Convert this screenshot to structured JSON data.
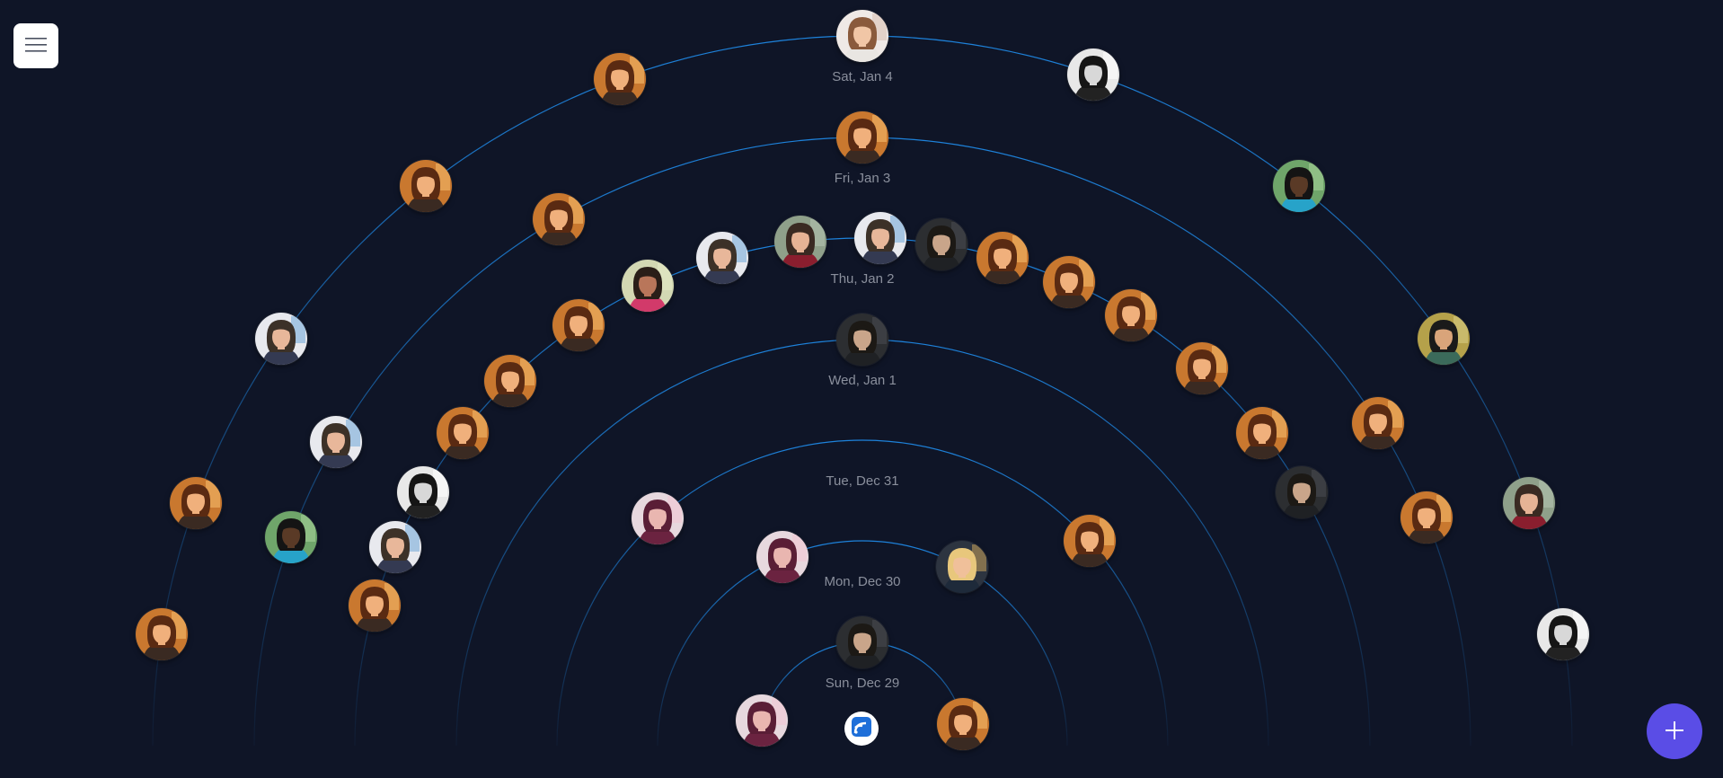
{
  "app": {
    "menu_icon": "hamburger-icon",
    "add_icon": "plus-icon",
    "logo_icon": "app-logo-icon",
    "colors": {
      "background": "#0f1527",
      "ring": "#1e88e5",
      "label": "#8a8f9c",
      "fab": "#5a4de6"
    }
  },
  "rings": [
    {
      "label": "Sun, Dec 29"
    },
    {
      "label": "Mon, Dec 30"
    },
    {
      "label": "Tue, Dec 31"
    },
    {
      "label": "Wed, Jan 1"
    },
    {
      "label": "Thu, Jan 2"
    },
    {
      "label": "Fri, Jan 3"
    },
    {
      "label": "Sat, Jan 4"
    }
  ],
  "avatar_types": {
    "woman_selfie": {
      "bg": "#c9782f",
      "hair": "#5a2a12",
      "skin": "#f0b07c",
      "shirt": "#3a2a22",
      "hl": "#f7c070"
    },
    "man_shirt": {
      "bg": "#e8e9ee",
      "hair": "#3c3128",
      "skin": "#e8b79a",
      "shirt": "#343a52",
      "hl": "#6fa8d8"
    },
    "man_dark": {
      "bg": "#2c2e31",
      "hair": "#1c1915",
      "skin": "#c9a58a",
      "shirt": "#1f2124",
      "hl": "#4a4d52"
    },
    "man_red": {
      "bg": "#8fa08a",
      "hair": "#3a2a22",
      "skin": "#e6b395",
      "shirt": "#8a1e2e",
      "hl": "#b7c4b3"
    },
    "woman_glasses": {
      "bg": "#e8e8e8",
      "hair": "#151515",
      "skin": "#d8d8d8",
      "shirt": "#222222",
      "hl": "#ffffff"
    },
    "woman_pink": {
      "bg": "#e7d8de",
      "hair": "#5a1e36",
      "skin": "#e9b6b0",
      "shirt": "#6b2340",
      "hl": "#f2c6d4"
    },
    "woman_blonde": {
      "bg": "#2d3440",
      "hair": "#e8c77c",
      "skin": "#f0c09a",
      "shirt": "#1e2a3a",
      "hl": "#c9a35a"
    },
    "woman_white": {
      "bg": "#efe9e6",
      "hair": "#8a5a3c",
      "skin": "#f1c6a6",
      "shirt": "#e9e6e2",
      "hl": "#d8c0b0"
    },
    "man_outdoor": {
      "bg": "#6fa56a",
      "hair": "#141414",
      "skin": "#5a3a26",
      "shirt": "#27a3c9",
      "hl": "#a9d39a"
    },
    "man_green": {
      "bg": "#b5a14a",
      "hair": "#1a1a1a",
      "skin": "#d9a47a",
      "shirt": "#3b6a5a",
      "hl": "#d9cf86"
    },
    "man_pink": {
      "bg": "#d3d8b3",
      "hair": "#2a1e18",
      "skin": "#b9765a",
      "shirt": "#d23a6a",
      "hl": "#e8ecc8"
    }
  },
  "people": [
    {
      "ring": 0,
      "deg": 12,
      "type": "woman_selfie"
    },
    {
      "ring": 0,
      "deg": 90,
      "type": "man_dark"
    },
    {
      "ring": 0,
      "deg": 166,
      "type": "woman_pink"
    },
    {
      "ring": 1,
      "deg": 61,
      "type": "woman_blonde"
    },
    {
      "ring": 1,
      "deg": 113,
      "type": "woman_pink"
    },
    {
      "ring": 2,
      "deg": 42,
      "type": "woman_selfie"
    },
    {
      "ring": 2,
      "deg": 132,
      "type": "woman_pink"
    },
    {
      "ring": 3,
      "deg": 90,
      "type": "man_dark"
    },
    {
      "ring": 4,
      "deg": 30,
      "type": "man_dark"
    },
    {
      "ring": 4,
      "deg": 38,
      "type": "woman_selfie"
    },
    {
      "ring": 4,
      "deg": 48,
      "type": "woman_selfie"
    },
    {
      "ring": 4,
      "deg": 58,
      "type": "woman_selfie"
    },
    {
      "ring": 4,
      "deg": 66,
      "type": "woman_selfie"
    },
    {
      "ring": 4,
      "deg": 74,
      "type": "woman_selfie"
    },
    {
      "ring": 4,
      "deg": 81,
      "type": "man_dark"
    },
    {
      "ring": 4,
      "deg": 88,
      "type": "man_shirt"
    },
    {
      "ring": 4,
      "deg": 97,
      "type": "man_red"
    },
    {
      "ring": 4,
      "deg": 106,
      "type": "man_shirt"
    },
    {
      "ring": 4,
      "deg": 115,
      "type": "man_pink"
    },
    {
      "ring": 4,
      "deg": 124,
      "type": "woman_selfie"
    },
    {
      "ring": 4,
      "deg": 134,
      "type": "woman_selfie"
    },
    {
      "ring": 4,
      "deg": 142,
      "type": "woman_selfie"
    },
    {
      "ring": 4,
      "deg": 150,
      "type": "woman_glasses"
    },
    {
      "ring": 4,
      "deg": 157,
      "type": "man_shirt"
    },
    {
      "ring": 4,
      "deg": 164,
      "type": "woman_selfie"
    },
    {
      "ring": 5,
      "deg": 90,
      "type": "woman_selfie"
    },
    {
      "ring": 5,
      "deg": 120,
      "type": "woman_selfie"
    },
    {
      "ring": 5,
      "deg": 150,
      "type": "man_shirt"
    },
    {
      "ring": 5,
      "deg": 32,
      "type": "woman_selfie"
    },
    {
      "ring": 5,
      "deg": 22,
      "type": "woman_selfie"
    },
    {
      "ring": 5,
      "deg": 160,
      "type": "man_outdoor"
    },
    {
      "ring": 6,
      "deg": 90,
      "type": "woman_white"
    },
    {
      "ring": 6,
      "deg": 110,
      "type": "woman_selfie"
    },
    {
      "ring": 6,
      "deg": 128,
      "type": "woman_selfie"
    },
    {
      "ring": 6,
      "deg": 145,
      "type": "man_shirt"
    },
    {
      "ring": 6,
      "deg": 160,
      "type": "woman_selfie"
    },
    {
      "ring": 6,
      "deg": 171,
      "type": "woman_selfie"
    },
    {
      "ring": 6,
      "deg": 71,
      "type": "woman_glasses"
    },
    {
      "ring": 6,
      "deg": 52,
      "type": "man_outdoor"
    },
    {
      "ring": 6,
      "deg": 35,
      "type": "man_green"
    },
    {
      "ring": 6,
      "deg": 20,
      "type": "man_red"
    },
    {
      "ring": 6,
      "deg": 9,
      "type": "woman_glasses"
    }
  ]
}
